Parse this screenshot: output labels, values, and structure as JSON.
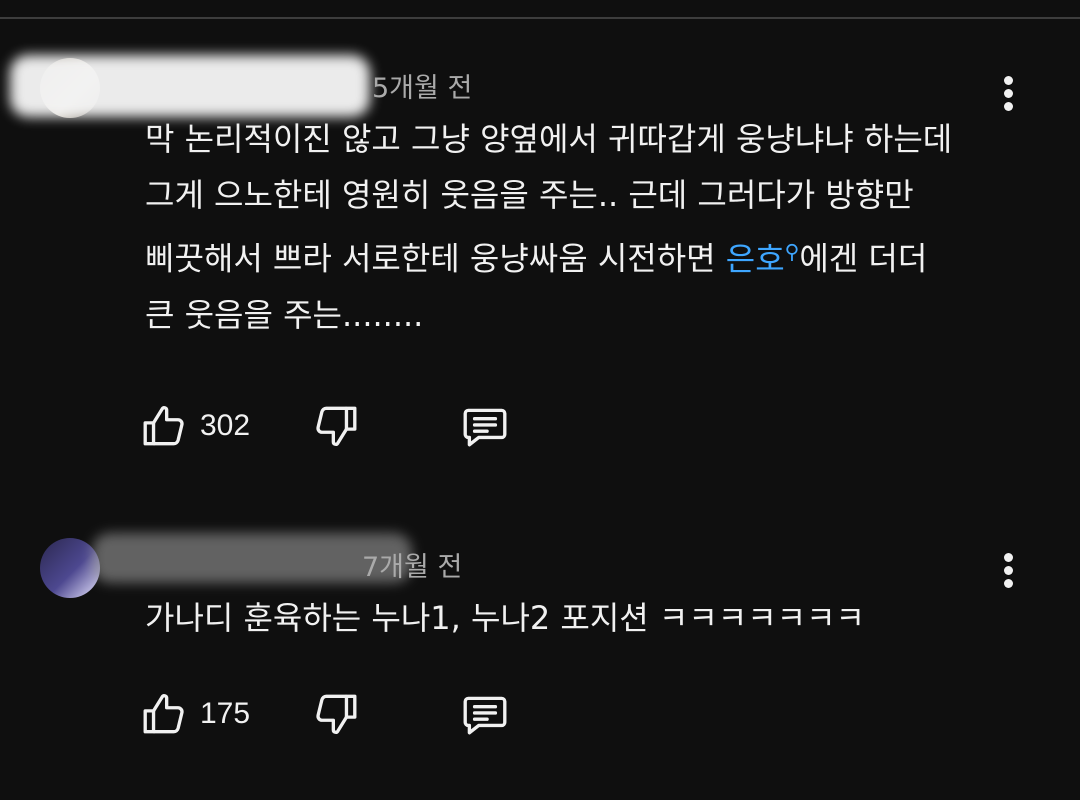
{
  "comments": [
    {
      "time": "5개월 전",
      "text_lines": [
        "막 논리적이진 않고 그냥 양옆에서 귀따갑게 웅냥냐냐 하는데",
        "그게 으노한테 영원히 웃음을 주는.. 근데 그러다가 방향만",
        "삐끗해서 쁘라 서로한테 웅냥싸움 시전하면 ",
        "큰 웃음을 주는........"
      ],
      "tag": "은호",
      "tag_suffix": "에겐 더더",
      "likes": "302"
    },
    {
      "time": "7개월 전",
      "text_lines": [
        "가나디 훈육하는 누나1, 누나2 포지션 ㅋㅋㅋㅋㅋㅋㅋ"
      ],
      "likes": "175"
    }
  ],
  "icons": {
    "like": "thumbs-up-icon",
    "dislike": "thumbs-down-icon",
    "reply": "reply-icon",
    "more": "more-vert-icon",
    "tag": "search-icon"
  },
  "colors": {
    "background": "#0f0f0f",
    "text": "#f1f1f1",
    "meta": "#aaaaaa",
    "link": "#3ea6ff"
  }
}
